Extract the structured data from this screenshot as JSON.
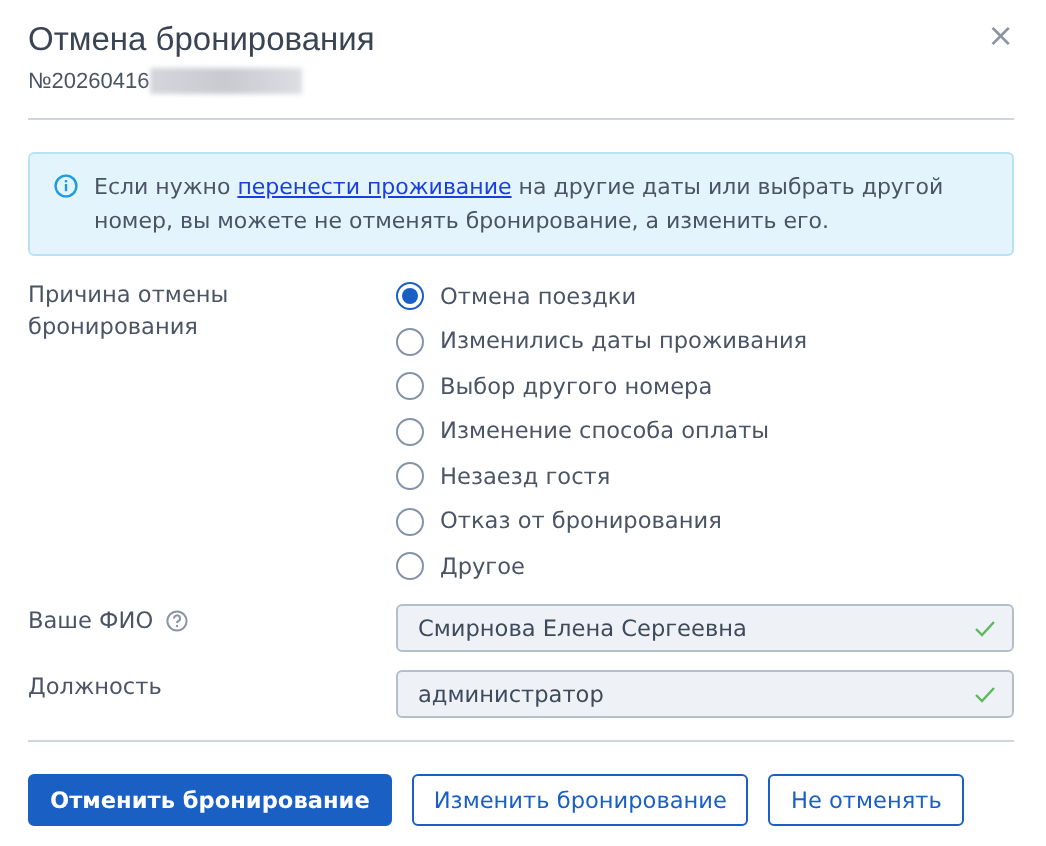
{
  "dialog": {
    "title": "Отмена бронирования",
    "booking_number": "№20260416",
    "close": "×"
  },
  "notice": {
    "before": "Если нужно ",
    "link": "перенести проживание",
    "after": " на другие даты или выбрать другой номер, вы можете не отменять бронирование, а изменить его."
  },
  "reason": {
    "label": "Причина отмены бронирования",
    "options": [
      {
        "label": "Отмена поездки",
        "selected": true
      },
      {
        "label": "Изменились даты проживания",
        "selected": false
      },
      {
        "label": "Выбор другого номера",
        "selected": false
      },
      {
        "label": "Изменение способа оплаты",
        "selected": false
      },
      {
        "label": "Незаезд гостя",
        "selected": false
      },
      {
        "label": "Отказ от бронирования",
        "selected": false
      },
      {
        "label": "Другое",
        "selected": false
      }
    ]
  },
  "fields": [
    {
      "label": "Ваше ФИО",
      "help": true,
      "value": "Смирнова Елена Сергеевна",
      "valid": true
    },
    {
      "label": "Должность",
      "help": false,
      "value": "администратор",
      "valid": true
    }
  ],
  "buttons": [
    {
      "label": "Отменить бронирование",
      "kind": "primary"
    },
    {
      "label": "Изменить бронирование",
      "kind": "secondary"
    },
    {
      "label": "Не отменять",
      "kind": "secondary"
    }
  ]
}
